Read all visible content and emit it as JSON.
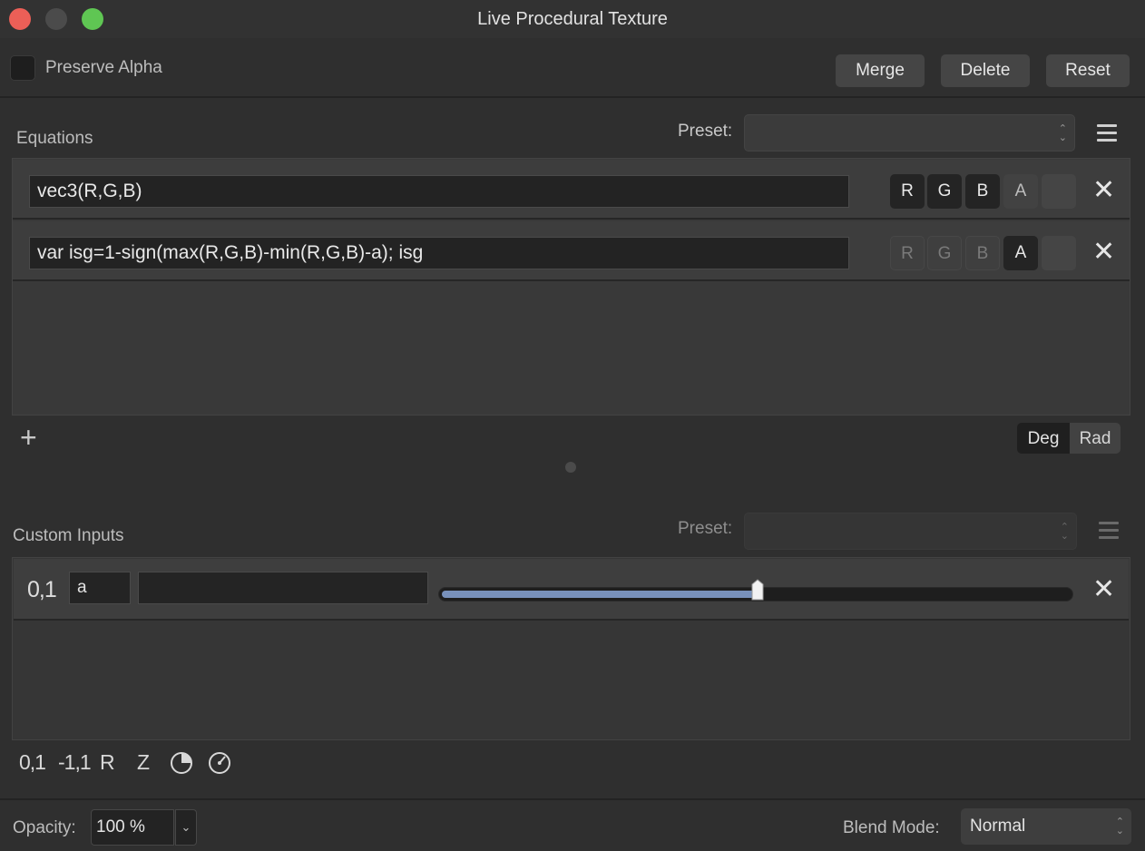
{
  "window": {
    "title": "Live Procedural Texture"
  },
  "top": {
    "preserve_alpha_label": "Preserve Alpha",
    "merge_label": "Merge",
    "delete_label": "Delete",
    "reset_label": "Reset"
  },
  "equations": {
    "section_label": "Equations",
    "preset_label": "Preset:",
    "preset_value": "",
    "rows": [
      {
        "expression": "vec3(R,G,B)",
        "channels": {
          "r": "R",
          "g": "G",
          "b": "B",
          "a": "A"
        },
        "active": [
          "R",
          "G",
          "B"
        ]
      },
      {
        "expression": "var isg=1-sign(max(R,G,B)-min(R,G,B)-a); isg",
        "channels": {
          "r": "R",
          "g": "G",
          "b": "B",
          "a": "A"
        },
        "active": [
          "A"
        ]
      }
    ],
    "add_icon": "plus-icon",
    "deg_label": "Deg",
    "rad_label": "Rad",
    "angle_mode": "Deg"
  },
  "custom_inputs": {
    "section_label": "Custom Inputs",
    "preset_label": "Preset:",
    "preset_value": "",
    "rows": [
      {
        "range": "0,1",
        "name": "a",
        "value": "",
        "slider_fraction": 0.5
      }
    ],
    "tools": {
      "range_01": "0,1",
      "range_m11": "-1,1",
      "r_label": "R",
      "z_label": "Z"
    }
  },
  "bottom": {
    "opacity_label": "Opacity:",
    "opacity_value": "100 %",
    "blend_mode_label": "Blend Mode:",
    "blend_mode_value": "Normal"
  },
  "colors": {
    "accent_slider": "#7891bb",
    "close_traffic": "#ec5f57",
    "max_traffic": "#5fc653"
  }
}
